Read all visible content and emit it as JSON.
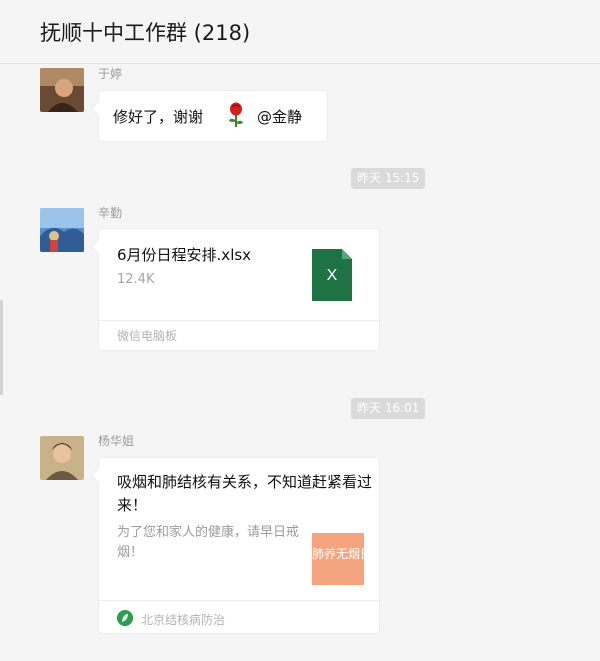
{
  "header": {
    "title": "抚顺十中工作群 (218)"
  },
  "messages": [
    {
      "sender": "于婷",
      "text_before": "修好了，谢谢",
      "emoji": "rose-icon",
      "text_after": "@金静"
    },
    {
      "timestamp": "昨天 15:15",
      "sender": "辛勤",
      "file": {
        "name": "6月份日程安排.xlsx",
        "size": "12.4K",
        "icon_letter": "X",
        "source": "微信电脑板"
      }
    },
    {
      "timestamp": "昨天 16:01",
      "sender": "杨华姐",
      "article": {
        "title": "吸烟和肺结核有关系，不知道赶紧看过来！",
        "desc": "为了您和家人的健康，请早日戒烟！",
        "thumb_text": "肺养无烟日",
        "source": "北京结核病防治"
      }
    }
  ],
  "colors": {
    "excel_green": "#1f7244",
    "source_green": "#2d9e4b",
    "thumb_orange": "#f4a57f"
  }
}
